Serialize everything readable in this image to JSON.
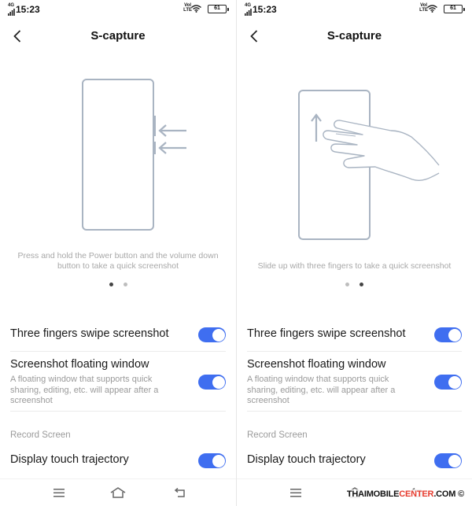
{
  "colors": {
    "accent": "#3f6ef0",
    "watermark_accent": "#e63b2e"
  },
  "screens": [
    {
      "status": {
        "network": "4G",
        "time": "15:23",
        "volte_top": "Vol",
        "volte_bottom": "LTE",
        "battery": "61"
      },
      "appbar": {
        "title": "S-capture",
        "back_icon": "back-arrow-icon"
      },
      "illustration": {
        "icon": "phone-power-volume-icon"
      },
      "caption": "Press and hold the Power button and the volume down button to take a quick screenshot",
      "pager": {
        "active_index": 0,
        "count": 2
      },
      "settings": {
        "three_finger": {
          "label": "Three fingers swipe screenshot",
          "enabled": true
        },
        "floating": {
          "label": "Screenshot floating window",
          "description": "A floating window that supports quick sharing, editing, etc. will appear after a screenshot",
          "enabled": true
        },
        "section_header": "Record Screen",
        "touch_trajectory": {
          "label": "Display touch trajectory",
          "enabled": true
        }
      },
      "nav": {
        "menu_icon": "menu-icon",
        "home_icon": "home-icon",
        "back_icon": "back-icon"
      }
    },
    {
      "status": {
        "network": "4G",
        "time": "15:23",
        "volte_top": "Vol",
        "volte_bottom": "LTE",
        "battery": "61"
      },
      "appbar": {
        "title": "S-capture",
        "back_icon": "back-arrow-icon"
      },
      "illustration": {
        "icon": "phone-three-finger-swipe-icon"
      },
      "caption": "Slide up with three fingers to take a quick screenshot",
      "pager": {
        "active_index": 1,
        "count": 2
      },
      "settings": {
        "three_finger": {
          "label": "Three fingers swipe screenshot",
          "enabled": true
        },
        "floating": {
          "label": "Screenshot floating window",
          "description": "A floating window that supports quick sharing, editing, etc. will appear after a screenshot",
          "enabled": true
        },
        "section_header": "Record Screen",
        "touch_trajectory": {
          "label": "Display touch trajectory",
          "enabled": true
        }
      },
      "nav": {
        "menu_icon": "menu-icon",
        "home_icon": "home-icon",
        "back_icon": "back-icon"
      }
    }
  ],
  "watermark": {
    "part1": "THAIMOBILE",
    "part2": "CENTER",
    "part3": ".COM",
    "symbol": "©"
  }
}
